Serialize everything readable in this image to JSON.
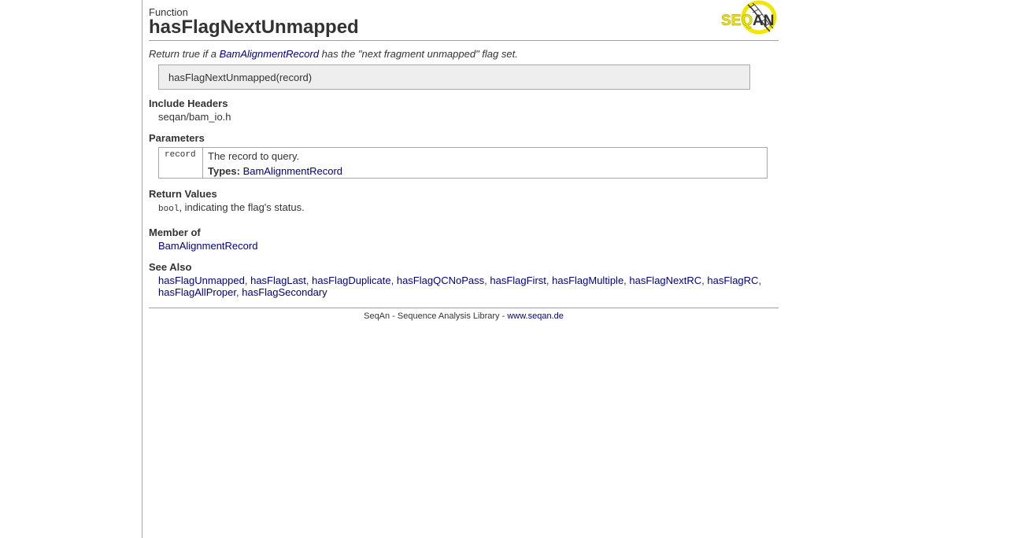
{
  "header": {
    "kind": "Function",
    "title": "hasFlagNextUnmapped",
    "logo_text": "SEQAN"
  },
  "summary": {
    "prefix": "Return true if a ",
    "link": "BamAlignmentRecord",
    "suffix": " has the \"next fragment unmapped\" flag set."
  },
  "signature": "hasFlagNextUnmapped(record)",
  "include_headers": {
    "heading": "Include Headers",
    "value": "seqan/bam_io.h"
  },
  "parameters": {
    "heading": "Parameters",
    "rows": [
      {
        "name": "record",
        "description": "The record to query.",
        "types_label": "Types:",
        "type": "BamAlignmentRecord"
      }
    ]
  },
  "return_values": {
    "heading": "Return Values",
    "type": "bool",
    "text": ", indicating the flag's status."
  },
  "member_of": {
    "heading": "Member of",
    "link": "BamAlignmentRecord"
  },
  "see_also": {
    "heading": "See Also",
    "links": [
      "hasFlagUnmapped",
      "hasFlagLast",
      "hasFlagDuplicate",
      "hasFlagQCNoPass",
      "hasFlagFirst",
      "hasFlagMultiple",
      "hasFlagNextRC",
      "hasFlagRC",
      "hasFlagAllProper",
      "hasFlagSecondary"
    ],
    "separator": ", "
  },
  "footer": {
    "text": "SeqAn - Sequence Analysis Library - ",
    "link": "www.seqan.de"
  },
  "colors": {
    "link": "#000080",
    "logo_yellow": "#f2e600",
    "text": "#333333"
  }
}
